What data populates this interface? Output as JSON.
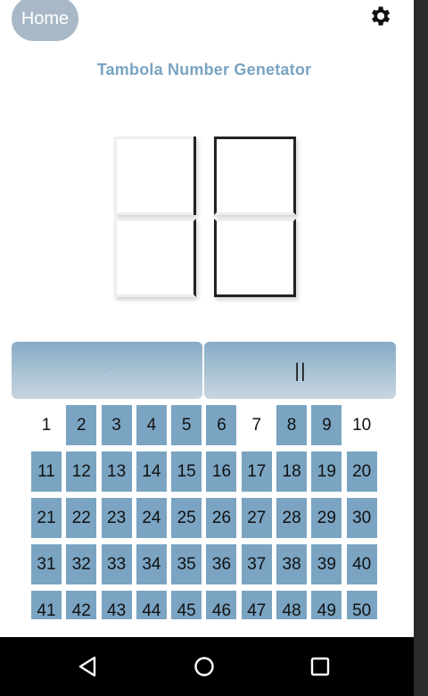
{
  "header": {
    "home_label": "Home"
  },
  "title": "Tambola Number Genetator",
  "controls": {
    "next_label": ">",
    "pause_label": "||"
  },
  "icons": {
    "settings": "gear-icon",
    "back": "triangle-back-icon",
    "home": "circle-home-icon",
    "recents": "square-recents-icon"
  },
  "colors": {
    "accent": "#7aa4c2",
    "home_button": "#a8b8c6"
  },
  "board": {
    "numbers": [
      1,
      2,
      3,
      4,
      5,
      6,
      7,
      8,
      9,
      10,
      11,
      12,
      13,
      14,
      15,
      16,
      17,
      18,
      19,
      20,
      21,
      22,
      23,
      24,
      25,
      26,
      27,
      28,
      29,
      30,
      31,
      32,
      33,
      34,
      35,
      36,
      37,
      38,
      39,
      40,
      41,
      42,
      43,
      44,
      45,
      46,
      47,
      48,
      49,
      50
    ],
    "called": [
      1,
      7,
      10
    ]
  }
}
